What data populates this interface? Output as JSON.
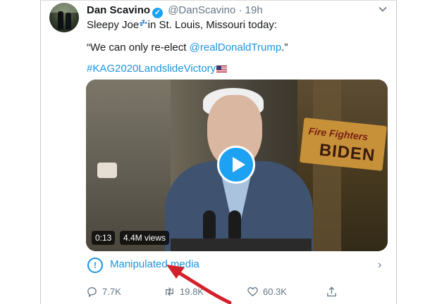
{
  "tweet": {
    "author_name": "Dan Scavino",
    "handle": "@DanScavino",
    "separator": "·",
    "time": "19h",
    "line1_prefix": "Sleepy Joe",
    "line1_zz": "💤",
    "line1_suffix": "in St. Louis, Missouri today:",
    "quote_open": "“We can only re-elect ",
    "quote_mention": "@realDonaldTrump",
    "quote_close": ".”",
    "hashtag": "#KAG2020LandslideVictory"
  },
  "video": {
    "duration": "0:13",
    "views": "4.4M views",
    "sign_line1": "Fire Fighters",
    "sign_line2": "BIDEN"
  },
  "notice": {
    "icon": "!",
    "label": "Manipulated media"
  },
  "actions": {
    "replies": "7.7K",
    "retweets": "19.8K",
    "likes": "60.3K"
  },
  "colors": {
    "link": "#1b95e0",
    "verified": "#1da1f2",
    "annotation_arrow": "#d4202a"
  }
}
